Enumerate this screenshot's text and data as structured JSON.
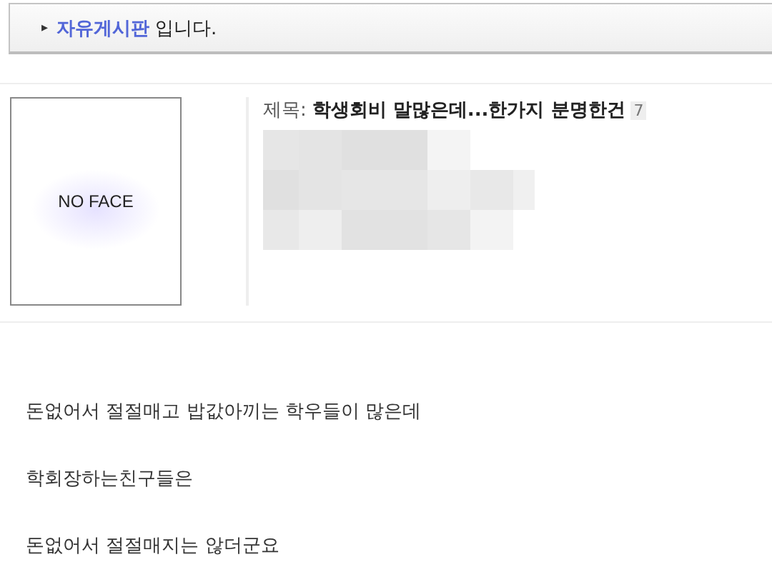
{
  "board_notice": {
    "arrow": "▸",
    "board_name": "자유게시판",
    "suffix": "입니다."
  },
  "post": {
    "avatar_text": "NO FACE",
    "title_label": "제목:",
    "title": "학생회비 말많은데...한가지 분명한건",
    "comment_count": "7"
  },
  "body": [
    "돈없어서 절절매고 밥값아끼는 학우들이 많은데",
    "학회장하는친구들은",
    "돈없어서 절절매지는 않더군요"
  ]
}
